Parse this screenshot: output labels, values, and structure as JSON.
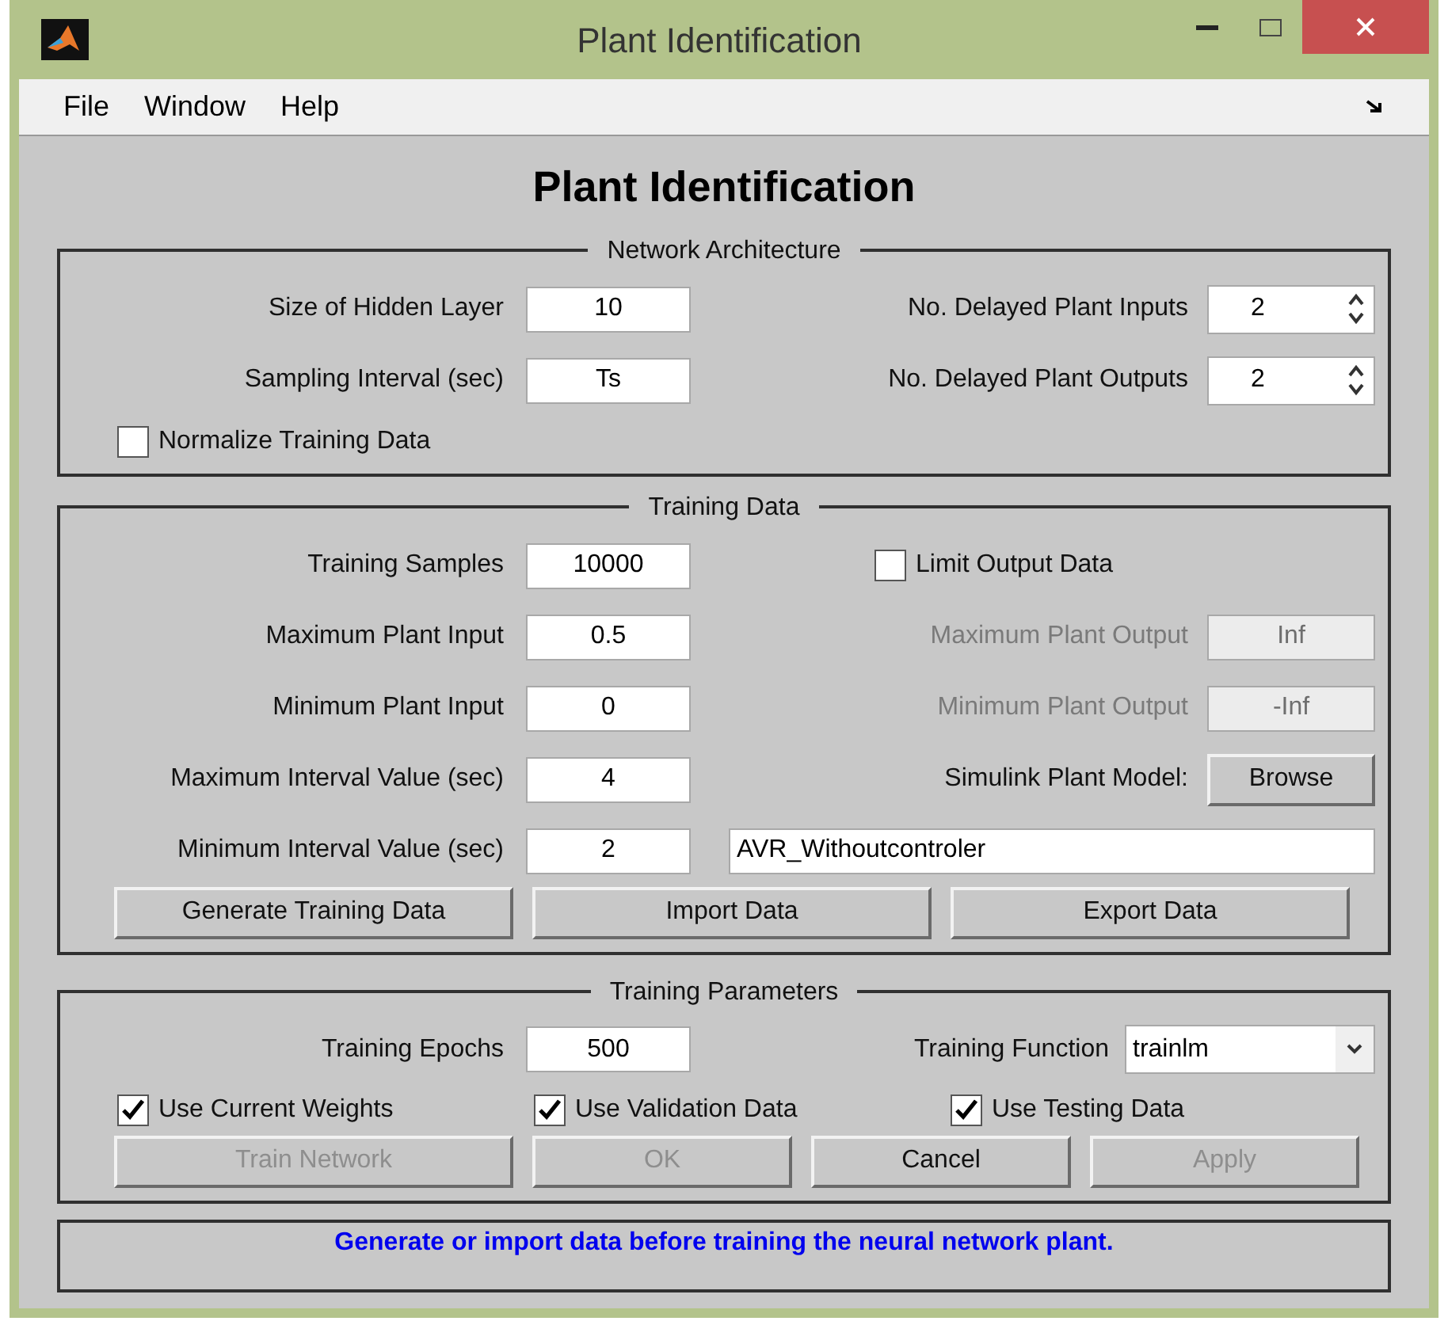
{
  "window": {
    "title": "Plant Identification"
  },
  "menu": [
    "File",
    "Window",
    "Help"
  ],
  "heading": "Plant Identification",
  "network_architecture": {
    "title": "Network Architecture",
    "rows": [
      {
        "label": "Size of Hidden Layer",
        "value": "10",
        "right_label": "No. Delayed Plant Inputs",
        "right_value": "2"
      },
      {
        "label": "Sampling Interval (sec)",
        "value": "Ts",
        "right_label": "No. Delayed Plant Outputs",
        "right_value": "2"
      }
    ],
    "checkbox": {
      "label": "Normalize Training Data",
      "checked": false
    }
  },
  "training_data": {
    "title": "Training Data",
    "rows": [
      {
        "label": "Training Samples",
        "value": "10000",
        "right": {
          "kind": "checkbox",
          "label": "Limit Output Data",
          "checked": false
        }
      },
      {
        "label": "Maximum Plant Input",
        "value": "0.5",
        "right": {
          "kind": "field",
          "label": "Maximum Plant Output",
          "value": "Inf",
          "disabled": true
        }
      },
      {
        "label": "Minimum Plant Input",
        "value": "0",
        "right": {
          "kind": "field",
          "label": "Minimum Plant Output",
          "value": "-Inf",
          "disabled": true
        }
      },
      {
        "label": "Maximum Interval Value (sec)",
        "value": "4",
        "right": {
          "kind": "button",
          "label": "Simulink Plant Model:",
          "button": "Browse"
        }
      },
      {
        "label": "Minimum Interval Value (sec)",
        "value": "2",
        "right": {
          "kind": "path",
          "value": "AVR_Withoutcontroler"
        }
      }
    ],
    "buttons": [
      {
        "label": "Generate Training Data",
        "disabled": false
      },
      {
        "label": "Import Data",
        "disabled": false
      },
      {
        "label": "Export Data",
        "disabled": false
      }
    ]
  },
  "training_parameters": {
    "title": "Training Parameters",
    "epochs": {
      "label": "Training Epochs",
      "value": "500"
    },
    "function": {
      "label": "Training Function",
      "value": "trainlm"
    },
    "checkboxes": [
      {
        "label": "Use Current Weights",
        "checked": true
      },
      {
        "label": "Use Validation Data",
        "checked": true
      },
      {
        "label": "Use Testing Data",
        "checked": true
      }
    ],
    "buttons": [
      {
        "label": "Train Network",
        "disabled": true
      },
      {
        "label": "OK",
        "disabled": true
      },
      {
        "label": "Cancel",
        "disabled": false
      },
      {
        "label": "Apply",
        "disabled": true
      }
    ]
  },
  "status": "Generate or import data before training the neural network plant."
}
